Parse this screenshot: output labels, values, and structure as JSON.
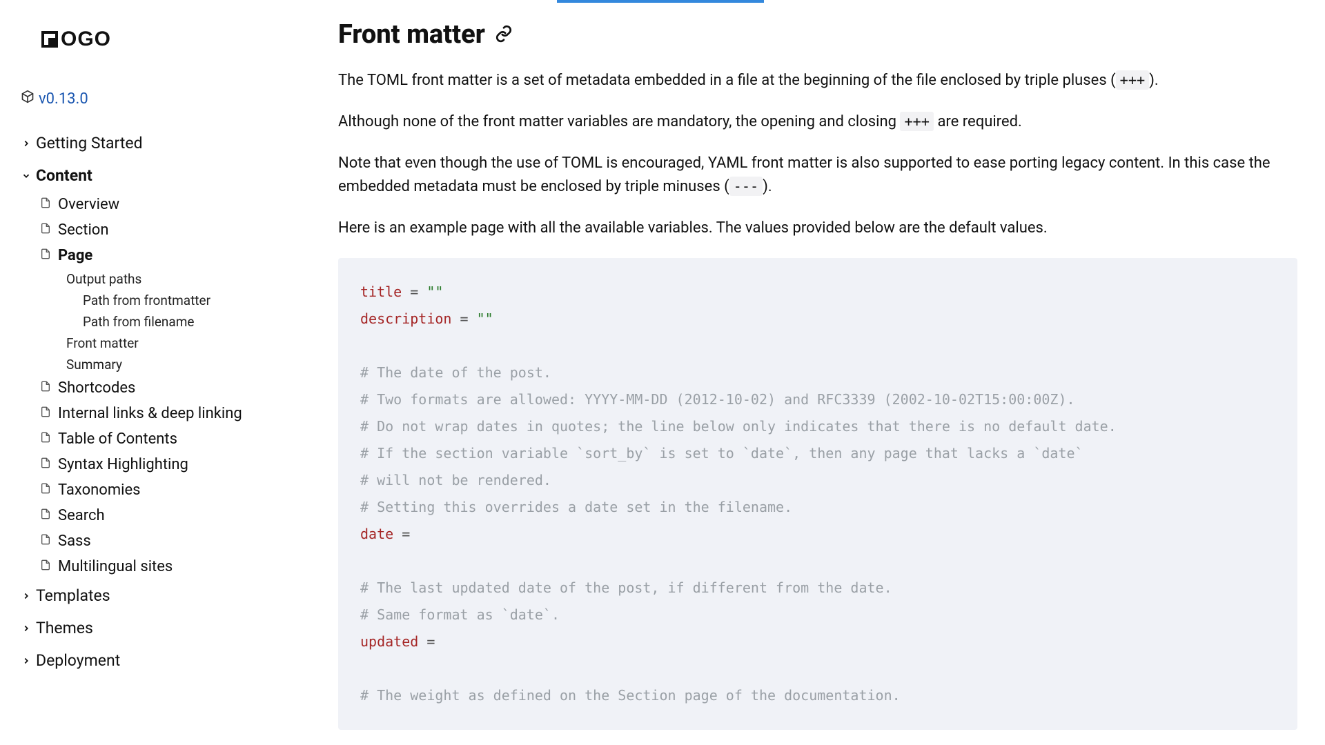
{
  "logo_text": "OGO",
  "version": "v0.13.0",
  "sidebar": {
    "sections": [
      {
        "label": "Getting Started",
        "open": false
      },
      {
        "label": "Content",
        "open": true,
        "children": [
          {
            "label": "Overview"
          },
          {
            "label": "Section"
          },
          {
            "label": "Page",
            "active": true,
            "children": [
              {
                "label": "Output paths",
                "children": [
                  {
                    "label": "Path from frontmatter"
                  },
                  {
                    "label": "Path from filename"
                  }
                ]
              },
              {
                "label": "Front matter"
              },
              {
                "label": "Summary"
              }
            ]
          },
          {
            "label": "Shortcodes"
          },
          {
            "label": "Internal links & deep linking"
          },
          {
            "label": "Table of Contents"
          },
          {
            "label": "Syntax Highlighting"
          },
          {
            "label": "Taxonomies"
          },
          {
            "label": "Search"
          },
          {
            "label": "Sass"
          },
          {
            "label": "Multilingual sites"
          }
        ]
      },
      {
        "label": "Templates",
        "open": false
      },
      {
        "label": "Themes",
        "open": false
      },
      {
        "label": "Deployment",
        "open": false
      }
    ]
  },
  "content": {
    "heading": "Front matter",
    "p1_a": "The TOML front matter is a set of metadata embedded in a file at the beginning of the file enclosed by triple pluses (",
    "p1_code": "+++",
    "p1_b": ").",
    "p2_a": "Although none of the front matter variables are mandatory, the opening and closing ",
    "p2_code": "+++",
    "p2_b": " are required.",
    "p3_a": "Note that even though the use of TOML is encouraged, YAML front matter is also supported to ease porting legacy content. In this case the embedded metadata must be enclosed by triple minuses (",
    "p3_code": "---",
    "p3_b": ").",
    "p4": "Here is an example page with all the available variables. The values provided below are the default values.",
    "code": {
      "k_title": "title",
      "eq": " = ",
      "v_empty": "\"\"",
      "k_description": "description",
      "c1": "# The date of the post.",
      "c2": "# Two formats are allowed: YYYY-MM-DD (2012-10-02) and RFC3339 (2002-10-02T15:00:00Z).",
      "c3": "# Do not wrap dates in quotes; the line below only indicates that there is no default date.",
      "c4": "# If the section variable `sort_by` is set to `date`, then any page that lacks a `date`",
      "c5": "# will not be rendered.",
      "c6": "# Setting this overrides a date set in the filename.",
      "k_date": "date",
      "eq_bare": " =",
      "c7": "# The last updated date of the post, if different from the date.",
      "c8": "# Same format as `date`.",
      "k_updated": "updated",
      "c9": "# The weight as defined on the Section page of the documentation."
    }
  }
}
